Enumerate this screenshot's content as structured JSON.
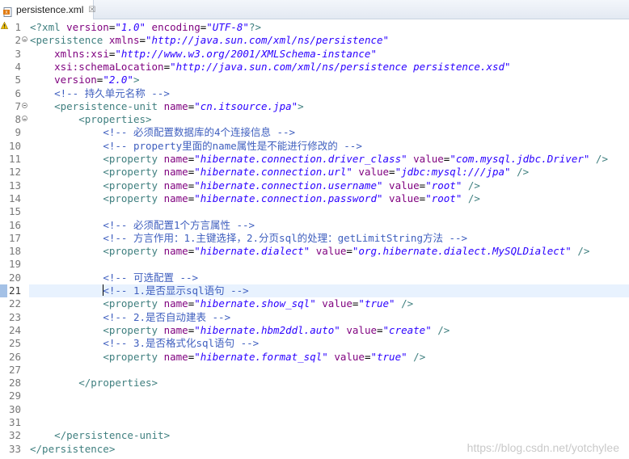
{
  "tab": {
    "filename": "persistence.xml",
    "close_glyph": "☒",
    "icon": "xml-file-icon"
  },
  "lines": [
    {
      "n": "1",
      "fold": false,
      "tokens": [
        [
          "t",
          "<?xml "
        ],
        [
          "a",
          "version"
        ],
        [
          "",
          "="
        ],
        [
          "v",
          "\"1.0\""
        ],
        [
          "a",
          " encoding"
        ],
        [
          "",
          "="
        ],
        [
          "v",
          "\"UTF-8\""
        ],
        [
          "t",
          "?>"
        ]
      ]
    },
    {
      "n": "2",
      "fold": true,
      "tokens": [
        [
          "t",
          "<persistence "
        ],
        [
          "a",
          "xmlns"
        ],
        [
          "",
          "="
        ],
        [
          "v",
          "\"http://java.sun.com/xml/ns/persistence\""
        ]
      ]
    },
    {
      "n": "3",
      "fold": false,
      "tokens": [
        [
          "",
          "    "
        ],
        [
          "a",
          "xmlns:xsi"
        ],
        [
          "",
          "="
        ],
        [
          "v",
          "\"http://www.w3.org/2001/XMLSchema-instance\""
        ]
      ]
    },
    {
      "n": "4",
      "fold": false,
      "tokens": [
        [
          "",
          "    "
        ],
        [
          "a",
          "xsi:schemaLocation"
        ],
        [
          "",
          "="
        ],
        [
          "v",
          "\"http://java.sun.com/xml/ns/persistence persistence.xsd\""
        ]
      ]
    },
    {
      "n": "5",
      "fold": false,
      "tokens": [
        [
          "",
          "    "
        ],
        [
          "a",
          "version"
        ],
        [
          "",
          "="
        ],
        [
          "v",
          "\"2.0\""
        ],
        [
          "t",
          ">"
        ]
      ]
    },
    {
      "n": "6",
      "fold": false,
      "tokens": [
        [
          "",
          "    "
        ],
        [
          "c",
          "<!-- 持久单元名称 -->"
        ]
      ]
    },
    {
      "n": "7",
      "fold": true,
      "tokens": [
        [
          "",
          "    "
        ],
        [
          "t",
          "<persistence-unit "
        ],
        [
          "a",
          "name"
        ],
        [
          "",
          "="
        ],
        [
          "v",
          "\"cn.itsource.jpa\""
        ],
        [
          "t",
          ">"
        ]
      ]
    },
    {
      "n": "8",
      "fold": true,
      "tokens": [
        [
          "",
          "        "
        ],
        [
          "t",
          "<properties>"
        ]
      ]
    },
    {
      "n": "9",
      "fold": false,
      "tokens": [
        [
          "",
          "            "
        ],
        [
          "c",
          "<!-- 必须配置数据库的4个连接信息 -->"
        ]
      ]
    },
    {
      "n": "10",
      "fold": false,
      "tokens": [
        [
          "",
          "            "
        ],
        [
          "c",
          "<!-- property里面的name属性是不能进行修改的 -->"
        ]
      ]
    },
    {
      "n": "11",
      "fold": false,
      "tokens": [
        [
          "",
          "            "
        ],
        [
          "t",
          "<property "
        ],
        [
          "a",
          "name"
        ],
        [
          "",
          "="
        ],
        [
          "v",
          "\"hibernate.connection.driver_class\""
        ],
        [
          "a",
          " value"
        ],
        [
          "",
          "="
        ],
        [
          "v",
          "\"com.mysql.jdbc.Driver\""
        ],
        [
          "t",
          " />"
        ]
      ]
    },
    {
      "n": "12",
      "fold": false,
      "tokens": [
        [
          "",
          "            "
        ],
        [
          "t",
          "<property "
        ],
        [
          "a",
          "name"
        ],
        [
          "",
          "="
        ],
        [
          "v",
          "\"hibernate.connection.url\""
        ],
        [
          "a",
          " value"
        ],
        [
          "",
          "="
        ],
        [
          "v",
          "\"jdbc:mysql:///jpa\""
        ],
        [
          "t",
          " />"
        ]
      ]
    },
    {
      "n": "13",
      "fold": false,
      "tokens": [
        [
          "",
          "            "
        ],
        [
          "t",
          "<property "
        ],
        [
          "a",
          "name"
        ],
        [
          "",
          "="
        ],
        [
          "v",
          "\"hibernate.connection.username\""
        ],
        [
          "a",
          " value"
        ],
        [
          "",
          "="
        ],
        [
          "v",
          "\"root\""
        ],
        [
          "t",
          " />"
        ]
      ]
    },
    {
      "n": "14",
      "fold": false,
      "tokens": [
        [
          "",
          "            "
        ],
        [
          "t",
          "<property "
        ],
        [
          "a",
          "name"
        ],
        [
          "",
          "="
        ],
        [
          "v",
          "\"hibernate.connection.password\""
        ],
        [
          "a",
          " value"
        ],
        [
          "",
          "="
        ],
        [
          "v",
          "\"root\""
        ],
        [
          "t",
          " />"
        ]
      ]
    },
    {
      "n": "15",
      "fold": false,
      "tokens": []
    },
    {
      "n": "16",
      "fold": false,
      "tokens": [
        [
          "",
          "            "
        ],
        [
          "c",
          "<!-- 必须配置1个方言属性 -->"
        ]
      ]
    },
    {
      "n": "17",
      "fold": false,
      "tokens": [
        [
          "",
          "            "
        ],
        [
          "c",
          "<!-- 方言作用：1.主键选择，2.分页sql的处理：getLimitString方法 -->"
        ]
      ]
    },
    {
      "n": "18",
      "fold": false,
      "tokens": [
        [
          "",
          "            "
        ],
        [
          "t",
          "<property "
        ],
        [
          "a",
          "name"
        ],
        [
          "",
          "="
        ],
        [
          "v",
          "\"hibernate.dialect\""
        ],
        [
          "a",
          " value"
        ],
        [
          "",
          "="
        ],
        [
          "v",
          "\"org.hibernate.dialect.MySQLDialect\""
        ],
        [
          "t",
          " />"
        ]
      ]
    },
    {
      "n": "19",
      "fold": false,
      "tokens": []
    },
    {
      "n": "20",
      "fold": false,
      "tokens": [
        [
          "",
          "            "
        ],
        [
          "c",
          "<!-- 可选配置 -->"
        ]
      ]
    },
    {
      "n": "21",
      "fold": false,
      "current": true,
      "tokens": [
        [
          "",
          "            "
        ],
        [
          "caret",
          ""
        ],
        [
          "c",
          "<!-- 1.是否显示sql语句 -->"
        ]
      ]
    },
    {
      "n": "22",
      "fold": false,
      "tokens": [
        [
          "",
          "            "
        ],
        [
          "t",
          "<property "
        ],
        [
          "a",
          "name"
        ],
        [
          "",
          "="
        ],
        [
          "v",
          "\"hibernate.show_sql\""
        ],
        [
          "a",
          " value"
        ],
        [
          "",
          "="
        ],
        [
          "v",
          "\"true\""
        ],
        [
          "t",
          " />"
        ]
      ]
    },
    {
      "n": "23",
      "fold": false,
      "tokens": [
        [
          "",
          "            "
        ],
        [
          "c",
          "<!-- 2.是否自动建表 -->"
        ]
      ]
    },
    {
      "n": "24",
      "fold": false,
      "tokens": [
        [
          "",
          "            "
        ],
        [
          "t",
          "<property "
        ],
        [
          "a",
          "name"
        ],
        [
          "",
          "="
        ],
        [
          "v",
          "\"hibernate.hbm2ddl.auto\""
        ],
        [
          "a",
          " value"
        ],
        [
          "",
          "="
        ],
        [
          "v",
          "\"create\""
        ],
        [
          "t",
          " />"
        ]
      ]
    },
    {
      "n": "25",
      "fold": false,
      "tokens": [
        [
          "",
          "            "
        ],
        [
          "c",
          "<!-- 3.是否格式化sql语句 -->"
        ]
      ]
    },
    {
      "n": "26",
      "fold": false,
      "tokens": [
        [
          "",
          "            "
        ],
        [
          "t",
          "<property "
        ],
        [
          "a",
          "name"
        ],
        [
          "",
          "="
        ],
        [
          "v",
          "\"hibernate.format_sql\""
        ],
        [
          "a",
          " value"
        ],
        [
          "",
          "="
        ],
        [
          "v",
          "\"true\""
        ],
        [
          "t",
          " />"
        ]
      ]
    },
    {
      "n": "27",
      "fold": false,
      "tokens": []
    },
    {
      "n": "28",
      "fold": false,
      "tokens": [
        [
          "",
          "        "
        ],
        [
          "t",
          "</properties>"
        ]
      ]
    },
    {
      "n": "29",
      "fold": false,
      "tokens": []
    },
    {
      "n": "30",
      "fold": false,
      "tokens": []
    },
    {
      "n": "31",
      "fold": false,
      "tokens": []
    },
    {
      "n": "32",
      "fold": false,
      "tokens": [
        [
          "",
          "    "
        ],
        [
          "t",
          "</persistence-unit>"
        ]
      ]
    },
    {
      "n": "33",
      "fold": false,
      "tokens": [
        [
          "t",
          "</persistence>"
        ]
      ]
    }
  ],
  "watermark": "https://blog.csdn.net/yotchylee",
  "colors": {
    "tag": "#3f7f7f",
    "attribute": "#7f007f",
    "value": "#2a00ff",
    "comment": "#3f5fbf",
    "current_line": "#e8f2fe"
  }
}
